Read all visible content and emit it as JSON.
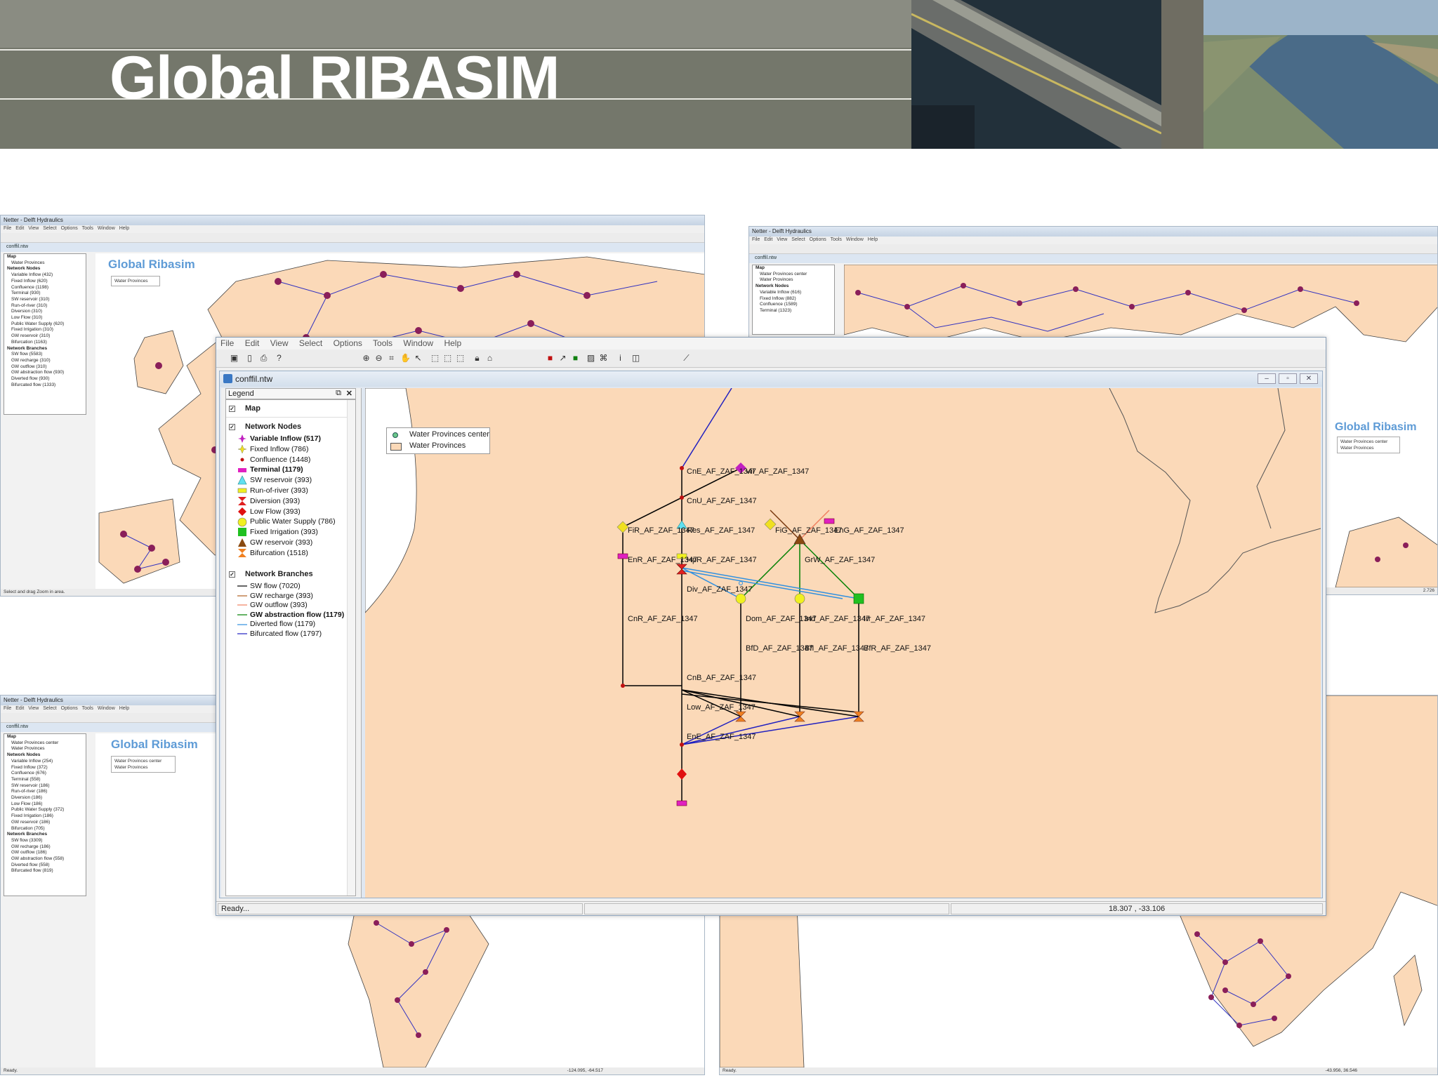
{
  "slide": {
    "title": "Global RIBASIM"
  },
  "background_windows": {
    "app_title": "Netter - Delft Hydraulics",
    "menu": "File Edit View Select Options Tools Window Help",
    "document": "conffil.ntw",
    "map_title": "Global Ribasim",
    "europe": {
      "legend_lines": [
        "Map",
        "Water Provinces",
        "Network Nodes",
        "Variable Inflow (432)",
        "Fixed Inflow (620)",
        "Confluence (1198)",
        "Terminal (930)",
        "SW reservoir (310)",
        "Run-of-river (310)",
        "Diversion (310)",
        "Low Flow (310)",
        "Public Water Supply (620)",
        "Fixed Irrigation (310)",
        "GW reservoir (310)",
        "Bifurcation (1163)",
        "Network Branches",
        "SW flow (5583)",
        "GW recharge (310)",
        "GW outflow (310)",
        "GW abstraction flow (930)",
        "Diverted flow (930)",
        "Bifurcated flow (1333)"
      ],
      "map_legend": [
        "Water Provinces"
      ],
      "status": "Select and drag Zoom in area."
    },
    "asia": {
      "legend_lines": [
        "Map",
        "Water Provinces center",
        "Water Provinces",
        "Network Nodes",
        "Variable Inflow (616)",
        "Fixed Inflow (882)",
        "Confluence (1589)",
        "Terminal (1323)"
      ],
      "map_legend": [
        "Water Provinces center",
        "Water Provinces"
      ],
      "status_coords": "2.726"
    },
    "america": {
      "legend_lines": [
        "Map",
        "Water Provinces center",
        "Water Provinces",
        "Network Nodes",
        "Variable Inflow (254)",
        "Fixed Inflow (372)",
        "Confluence (676)",
        "Terminal (558)",
        "SW reservoir (186)",
        "Run-of-river (186)",
        "Diversion (186)",
        "Low Flow (186)",
        "Public Water Supply (372)",
        "Fixed Irrigation (186)",
        "GW reservoir (186)",
        "Bifurcation (705)",
        "Network Branches",
        "SW flow (3309)",
        "GW recharge (186)",
        "GW outflow (186)",
        "GW abstraction flow (558)",
        "Diverted flow (558)",
        "Bifurcated flow (819)"
      ],
      "map_legend": [
        "Water Provinces center",
        "Water Provinces"
      ],
      "status": "Ready.",
      "status_coords": "-124.095, -64.517"
    },
    "africa": {
      "status": "Ready.",
      "status_coords": "-43.956, 36.546"
    }
  },
  "main_window": {
    "menu": [
      "File",
      "Edit",
      "View",
      "Select",
      "Options",
      "Tools",
      "Window",
      "Help"
    ],
    "document_title": "conffil.ntw",
    "legend": {
      "header": "Legend",
      "map_section": "Map",
      "nodes_section": "Network Nodes",
      "nodes": [
        {
          "label": "Variable Inflow (517)",
          "bold": true,
          "symbol": "variable-inflow",
          "color": "#c020c0"
        },
        {
          "label": "Fixed Inflow (786)",
          "bold": false,
          "symbol": "fixed-inflow",
          "color": "#f0e020"
        },
        {
          "label": "Confluence (1448)",
          "bold": false,
          "symbol": "confluence",
          "color": "#c01010"
        },
        {
          "label": "Terminal (1179)",
          "bold": true,
          "symbol": "terminal",
          "color": "#e020c0"
        },
        {
          "label": "SW reservoir (393)",
          "bold": false,
          "symbol": "sw-reservoir",
          "color": "#60e0f0"
        },
        {
          "label": "Run-of-river (393)",
          "bold": false,
          "symbol": "run-of-river",
          "color": "#f0f020"
        },
        {
          "label": "Diversion (393)",
          "bold": false,
          "symbol": "diversion",
          "color": "#e02020"
        },
        {
          "label": "Low Flow (393)",
          "bold": false,
          "symbol": "low-flow",
          "color": "#e01010"
        },
        {
          "label": "Public Water Supply (786)",
          "bold": false,
          "symbol": "public-water-supply",
          "color": "#f0f020"
        },
        {
          "label": "Fixed Irrigation (393)",
          "bold": false,
          "symbol": "fixed-irrigation",
          "color": "#20c020"
        },
        {
          "label": "GW reservoir (393)",
          "bold": false,
          "symbol": "gw-reservoir",
          "color": "#8a4a10"
        },
        {
          "label": "Bifurcation (1518)",
          "bold": false,
          "symbol": "bifurcation",
          "color": "#f08020"
        }
      ],
      "branches_section": "Network Branches",
      "branches": [
        {
          "label": "SW flow (7020)",
          "bold": false,
          "color": "#000000"
        },
        {
          "label": "GW recharge (393)",
          "bold": false,
          "color": "#b06020"
        },
        {
          "label": "GW outflow (393)",
          "bold": false,
          "color": "#f08060"
        },
        {
          "label": "GW abstraction flow (1179)",
          "bold": true,
          "color": "#008000"
        },
        {
          "label": "Diverted flow (1179)",
          "bold": false,
          "color": "#3090e0"
        },
        {
          "label": "Bifurcated flow (1797)",
          "bold": false,
          "color": "#2020c0"
        }
      ]
    },
    "map_legend": [
      "Water Provinces center",
      "Water Provinces"
    ],
    "nodes": {
      "CnE": "CnE_AF_ZAF_1347",
      "ViI": "ViI_AF_ZAF_1347",
      "CnU": "CnU_AF_ZAF_1347",
      "FiR": "FiR_AF_ZAF_1347",
      "Res": "Res_AF_ZAF_1347",
      "FiG": "FiG_AF_ZAF_1347",
      "EnG": "EnG_AF_ZAF_1347",
      "EnR": "EnR_AF_ZAF_1347",
      "HpR": "HpR_AF_ZAF_1347",
      "GrW": "GrW_AF_ZAF_1347",
      "Div": "Div_AF_ZAF_1347",
      "CnR": "CnR_AF_ZAF_1347",
      "Dom": "Dom_AF_ZAF_1347",
      "Ind": "Ind_AF_ZAF_1347",
      "Irr": "Irr_AF_ZAF_1347",
      "BfD": "BfD_AF_ZAF_1347",
      "BfI": "BfI_AF_ZAF_1347",
      "BfR": "BfR_AF_ZAF_1347",
      "CnB": "CnB_AF_ZAF_1347",
      "Low": "Low_AF_ZAF_1347",
      "EnE": "EnE_AF_ZAF_1347"
    },
    "status": {
      "message": "Ready...",
      "coordinates": "18.307 , -33.106"
    },
    "colors": {
      "province_fill": "#fbd9b8",
      "sea": "#ffffff"
    }
  }
}
